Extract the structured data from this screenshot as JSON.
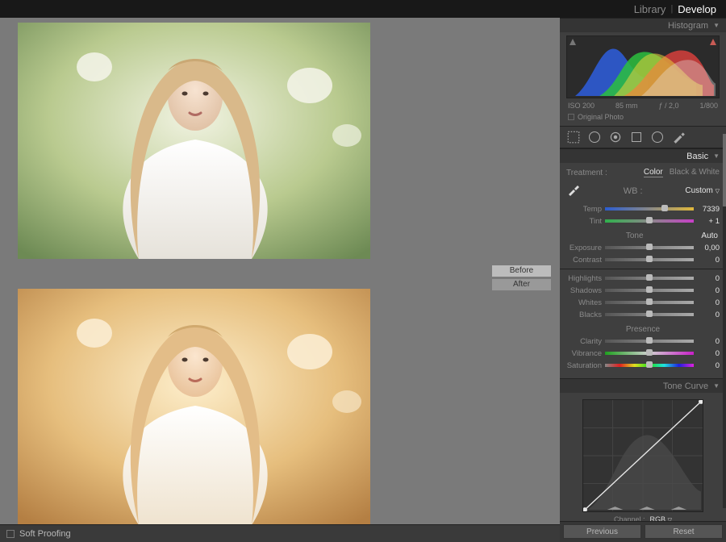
{
  "top_tabs": {
    "library": "Library",
    "develop": "Develop"
  },
  "preview": {
    "before_label": "Before",
    "after_label": "After"
  },
  "bottom": {
    "soft_proofing": "Soft Proofing"
  },
  "histogram": {
    "title": "Histogram",
    "exif": {
      "iso": "ISO 200",
      "focal": "85 mm",
      "aperture": "ƒ / 2,0",
      "shutter": "1/800"
    },
    "original": "Original Photo"
  },
  "basic": {
    "title": "Basic",
    "treatment_label": "Treatment :",
    "treatment_color": "Color",
    "treatment_bw": "Black & White",
    "wb_label": "WB :",
    "wb_value": "Custom",
    "sliders": {
      "temp": {
        "label": "Temp",
        "value": "7339",
        "pos": 67
      },
      "tint": {
        "label": "Tint",
        "value": "+ 1",
        "pos": 50
      }
    },
    "tone": {
      "label": "Tone",
      "auto": "Auto",
      "exposure": {
        "label": "Exposure",
        "value": "0,00",
        "pos": 50
      },
      "contrast": {
        "label": "Contrast",
        "value": "0",
        "pos": 50
      },
      "highlights": {
        "label": "Highlights",
        "value": "0",
        "pos": 50
      },
      "shadows": {
        "label": "Shadows",
        "value": "0",
        "pos": 50
      },
      "whites": {
        "label": "Whites",
        "value": "0",
        "pos": 50
      },
      "blacks": {
        "label": "Blacks",
        "value": "0",
        "pos": 50
      }
    },
    "presence": {
      "label": "Presence",
      "clarity": {
        "label": "Clarity",
        "value": "0",
        "pos": 50
      },
      "vibrance": {
        "label": "Vibrance",
        "value": "0",
        "pos": 50
      },
      "saturation": {
        "label": "Saturation",
        "value": "0",
        "pos": 50
      }
    }
  },
  "tone_curve": {
    "title": "Tone Curve",
    "channel_label": "Channel :",
    "channel_value": "RGB"
  },
  "footer": {
    "previous": "Previous",
    "reset": "Reset"
  }
}
